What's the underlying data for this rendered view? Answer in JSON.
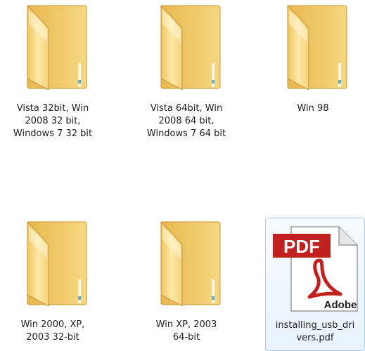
{
  "window": {
    "view": "Large icons"
  },
  "items": [
    {
      "type": "folder",
      "icon": "folder-icon",
      "label": "Vista 32bit, Win\n2008 32 bit,\nWindows 7 32 bit"
    },
    {
      "type": "folder",
      "icon": "folder-icon",
      "label": "Vista 64bit, Win\n2008 64 bit,\nWindows 7 64 bit"
    },
    {
      "type": "folder",
      "icon": "folder-icon",
      "label": "Win 98"
    },
    {
      "type": "folder",
      "icon": "folder-icon",
      "label": "Win 2000, XP,\n2003 32-bit"
    },
    {
      "type": "folder",
      "icon": "folder-icon",
      "label": "Win XP, 2003\n64-bit"
    },
    {
      "type": "pdf",
      "icon": "pdf-file-icon",
      "label": "installing_usb_dri\nvers.pdf",
      "badge": "PDF",
      "brand": "Adobe"
    }
  ],
  "colors": {
    "folder_light": "#fbe7a6",
    "folder_mid": "#f4cf6d",
    "folder_dark": "#d9a43a",
    "pdf_red": "#c21f1f",
    "selection_border": "#a7cfe8"
  }
}
